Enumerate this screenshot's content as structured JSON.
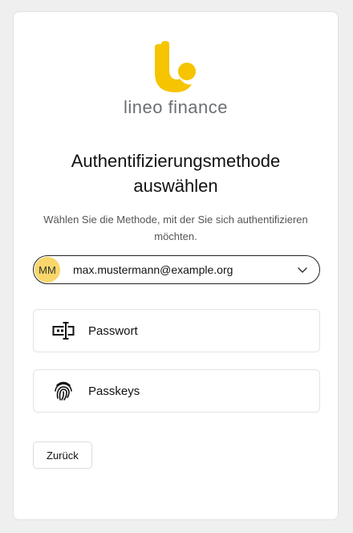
{
  "brand": {
    "name": "lineo finance",
    "accent_color": "#f6c400",
    "logo_icon": "lineo-logo-icon"
  },
  "heading": {
    "title": "Authentifizierungsmethode auswählen",
    "subtitle": "Wählen Sie die Methode, mit der Sie sich authentifizieren möchten."
  },
  "account": {
    "initials": "MM",
    "email": "max.mustermann@example.org",
    "avatar_color": "#f9d76a",
    "dropdown_icon": "chevron-down-icon"
  },
  "methods": [
    {
      "label": "Passwort",
      "icon": "password-icon"
    },
    {
      "label": "Passkeys",
      "icon": "fingerprint-icon"
    }
  ],
  "actions": {
    "back_label": "Zurück"
  }
}
